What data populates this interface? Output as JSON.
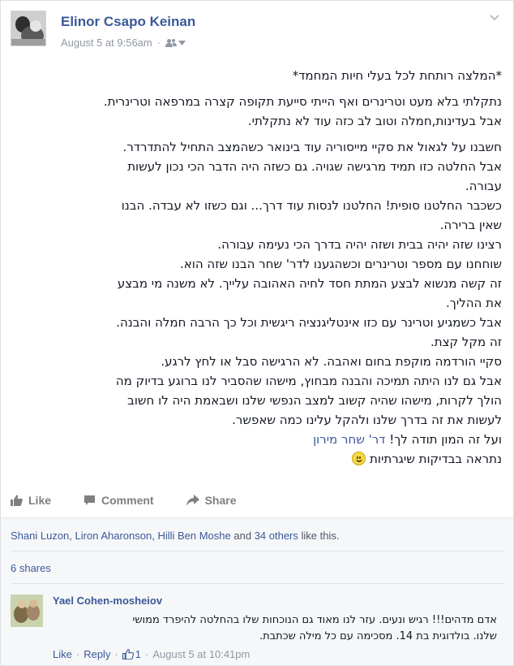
{
  "post": {
    "author": "Elinor Csapo Keinan",
    "timestamp": "August 5 at 9:56am",
    "audience_icon": "friends-icon",
    "options_icon": "chevron-down-icon",
    "paragraphs": [
      [
        "*המלצה רותחת לכל בעלי חיות המחמד*"
      ],
      [
        "נתקלתי בלא מעט וטרינרים ואף הייתי סייעת תקופה קצרה במרפאה וטרינרית.",
        "אבל בעדינות,חמלה וטוב לב כזה עוד לא נתקלתי."
      ],
      [
        "חשבנו על לגאול את סקיי מייסוריה עוד בינואר כשהמצב התחיל להתדרדר.",
        "אבל החלטה כזו תמיד מרגישה שגויה. גם כשזה היה הדבר הכי נכון לעשות",
        "עבורה.",
        "כשכבר החלטנו סופית! החלטנו לנסות עוד דרך... וגם כשזו לא עבדה. הבנו",
        "שאין ברירה.",
        "רצינו שזה יהיה בבית ושזה יהיה בדרך הכי נעימה עבורה.",
        "שוחחנו עם מספר וטרינרים וכשהגענו לדר' שחר הבנו שזה הוא.",
        "זה קשה מנשוא לבצע המתת חסד לחיה האהובה עלייך. לא משנה מי מבצע",
        "את ההליך.",
        "אבל כשמגיע וטרינר עם כזו אינטליגנציה ריגשית וכל כך הרבה חמלה והבנה.",
        "זה מקל קצת.",
        "סקיי הורדמה מוקפת בחום ואהבה. לא הרגישה סבל או לחץ לרגע.",
        "אבל גם לנו היתה תמיכה והבנה מבחוץ, מישהו שהסביר לנו ברוגע בדיוק מה",
        "הולך לקרות, מישהו שהיה קשוב למצב הנפשי שלנו ושבאמת היה לו חשוב",
        "לעשות את זה בדרך שלנו ולהקל עלינו כמה שאפשר."
      ],
      [
        "ועל זה המון תודה לך! ",
        "נתראה בבדיקות שיגרתיות"
      ]
    ],
    "tag": "דר' שחר מירון",
    "emoji": "smile-emoji"
  },
  "actions": {
    "like": "Like",
    "comment": "Comment",
    "share": "Share"
  },
  "likes": {
    "names": [
      "Shani Luzon",
      "Liron Aharonson",
      "Hilli Ben Moshe"
    ],
    "separator": ", ",
    "and": " and ",
    "others": "34 others",
    "suffix": " like this."
  },
  "shares": "6 shares",
  "comment": {
    "author": "Yael Cohen-mosheiov",
    "lines": [
      "אדם מדהים!!! רגיש ונעים. עזר לנו מאוד גם הנוכחות שלו בהחלטה להיפרד ממושי",
      "שלנו. בולדוגית בת 14. מסכימה עם כל מילה שכתבת."
    ],
    "like": "Like",
    "reply": "Reply",
    "like_count": "1",
    "timestamp": "August 5 at 10:41pm",
    "dot": "·"
  },
  "colors": {
    "link": "#3b5998",
    "muted": "#9197a3",
    "text": "#141823",
    "panel": "#f6f7f9"
  }
}
